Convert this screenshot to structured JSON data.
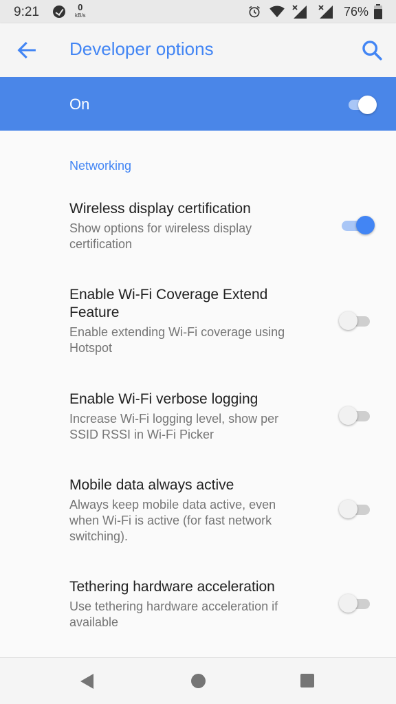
{
  "status_bar": {
    "time": "9:21",
    "net_speed_value": "0",
    "net_speed_unit": "kB/s",
    "battery_percent": "76%",
    "icons": [
      "music-app-icon",
      "alarm-icon",
      "wifi-icon",
      "signal-icon",
      "signal-icon",
      "battery-icon"
    ]
  },
  "app_bar": {
    "title": "Developer options",
    "back_icon": "arrow-back-icon",
    "search_icon": "search-icon"
  },
  "master_toggle": {
    "label": "On",
    "enabled": true
  },
  "section": {
    "header": "Networking"
  },
  "preferences": [
    {
      "title": "Wireless display certification",
      "summary": "Show options for wireless display certification",
      "enabled": true
    },
    {
      "title": "Enable Wi-Fi Coverage Extend Feature",
      "summary": "Enable extending Wi-Fi coverage using Hotspot",
      "enabled": false
    },
    {
      "title": "Enable Wi-Fi verbose logging",
      "summary": "Increase Wi-Fi logging level, show per SSID RSSI in Wi-Fi Picker",
      "enabled": false
    },
    {
      "title": "Mobile data always active",
      "summary": "Always keep mobile data active, even when Wi-Fi is active (for fast network switching).",
      "enabled": false
    },
    {
      "title": "Tethering hardware acceleration",
      "summary": "Use tethering hardware acceleration if available",
      "enabled": false
    }
  ],
  "nav_bar": {
    "icons": [
      "nav-back-icon",
      "nav-home-icon",
      "nav-recents-icon"
    ]
  },
  "colors": {
    "accent": "#4285f4",
    "master_bar": "#4a86e8",
    "switch_on_track": "#a9c6f6",
    "switch_off_track": "#cfcfcf"
  }
}
